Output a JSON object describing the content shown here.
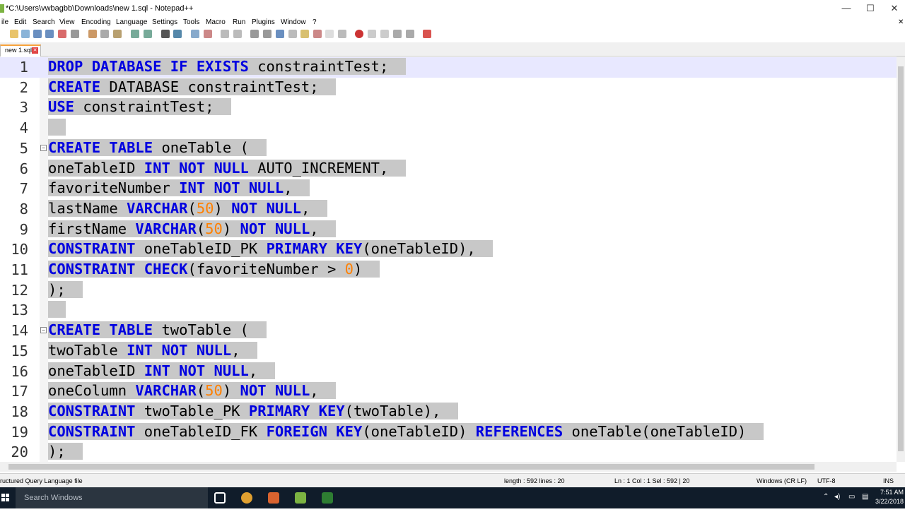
{
  "window": {
    "title": "*C:\\Users\\vwbagbb\\Downloads\\new 1.sql - Notepad++",
    "minimize": "—",
    "maximize": "☐",
    "close": "✕",
    "menu_close": "✕"
  },
  "menu": [
    "ile",
    "Edit",
    "Search",
    "View",
    "Encoding",
    "Language",
    "Settings",
    "Tools",
    "Macro",
    "Run",
    "Plugins",
    "Window",
    "?"
  ],
  "tab": {
    "label": "new 1.sql",
    "close": "✕"
  },
  "lines": [
    {
      "n": "1",
      "tokens": [
        {
          "t": "DROP DATABASE IF EXISTS",
          "k": "kw"
        },
        {
          "t": " constraintTest;",
          "k": ""
        }
      ]
    },
    {
      "n": "2",
      "tokens": [
        {
          "t": "CREATE",
          "k": "kw"
        },
        {
          "t": " DATABASE constraintTest;",
          "k": ""
        }
      ]
    },
    {
      "n": "3",
      "tokens": [
        {
          "t": "USE",
          "k": "kw"
        },
        {
          "t": " constraintTest;",
          "k": ""
        }
      ]
    },
    {
      "n": "4",
      "tokens": []
    },
    {
      "n": "5",
      "fold": true,
      "tokens": [
        {
          "t": "CREATE TABLE",
          "k": "kw"
        },
        {
          "t": " oneTable (",
          "k": ""
        }
      ]
    },
    {
      "n": "6",
      "tokens": [
        {
          "t": "oneTableID ",
          "k": ""
        },
        {
          "t": "INT NOT NULL",
          "k": "kw"
        },
        {
          "t": " AUTO_INCREMENT,",
          "k": ""
        }
      ]
    },
    {
      "n": "7",
      "tokens": [
        {
          "t": "favoriteNumber ",
          "k": ""
        },
        {
          "t": "INT NOT NULL",
          "k": "kw"
        },
        {
          "t": ",",
          "k": ""
        }
      ]
    },
    {
      "n": "8",
      "tokens": [
        {
          "t": "lastName ",
          "k": ""
        },
        {
          "t": "VARCHAR",
          "k": "kw"
        },
        {
          "t": "(",
          "k": ""
        },
        {
          "t": "50",
          "k": "num"
        },
        {
          "t": ") ",
          "k": ""
        },
        {
          "t": "NOT NULL",
          "k": "kw"
        },
        {
          "t": ",",
          "k": ""
        }
      ]
    },
    {
      "n": "9",
      "tokens": [
        {
          "t": "firstName ",
          "k": ""
        },
        {
          "t": "VARCHAR",
          "k": "kw"
        },
        {
          "t": "(",
          "k": ""
        },
        {
          "t": "50",
          "k": "num"
        },
        {
          "t": ") ",
          "k": ""
        },
        {
          "t": "NOT NULL",
          "k": "kw"
        },
        {
          "t": ",",
          "k": ""
        }
      ]
    },
    {
      "n": "10",
      "tokens": [
        {
          "t": "CONSTRAINT",
          "k": "kw"
        },
        {
          "t": " oneTableID_PK ",
          "k": ""
        },
        {
          "t": "PRIMARY KEY",
          "k": "kw"
        },
        {
          "t": "(oneTableID),",
          "k": ""
        }
      ]
    },
    {
      "n": "11",
      "tokens": [
        {
          "t": "CONSTRAINT CHECK",
          "k": "kw"
        },
        {
          "t": "(favoriteNumber > ",
          "k": ""
        },
        {
          "t": "0",
          "k": "num"
        },
        {
          "t": ")",
          "k": ""
        }
      ]
    },
    {
      "n": "12",
      "tokens": [
        {
          "t": ");",
          "k": ""
        }
      ]
    },
    {
      "n": "13",
      "tokens": []
    },
    {
      "n": "14",
      "fold": true,
      "tokens": [
        {
          "t": "CREATE TABLE",
          "k": "kw"
        },
        {
          "t": " twoTable (",
          "k": ""
        }
      ]
    },
    {
      "n": "15",
      "tokens": [
        {
          "t": "twoTable ",
          "k": ""
        },
        {
          "t": "INT NOT NULL",
          "k": "kw"
        },
        {
          "t": ",",
          "k": ""
        }
      ]
    },
    {
      "n": "16",
      "tokens": [
        {
          "t": "oneTableID ",
          "k": ""
        },
        {
          "t": "INT NOT NULL",
          "k": "kw"
        },
        {
          "t": ",",
          "k": ""
        }
      ]
    },
    {
      "n": "17",
      "tokens": [
        {
          "t": "oneColumn ",
          "k": ""
        },
        {
          "t": "VARCHAR",
          "k": "kw"
        },
        {
          "t": "(",
          "k": ""
        },
        {
          "t": "50",
          "k": "num"
        },
        {
          "t": ") ",
          "k": ""
        },
        {
          "t": "NOT NULL",
          "k": "kw"
        },
        {
          "t": ",",
          "k": ""
        }
      ]
    },
    {
      "n": "18",
      "tokens": [
        {
          "t": "CONSTRAINT",
          "k": "kw"
        },
        {
          "t": " twoTable_PK ",
          "k": ""
        },
        {
          "t": "PRIMARY KEY",
          "k": "kw"
        },
        {
          "t": "(twoTable),",
          "k": ""
        }
      ]
    },
    {
      "n": "19",
      "tokens": [
        {
          "t": "CONSTRAINT",
          "k": "kw"
        },
        {
          "t": " oneTableID_FK ",
          "k": ""
        },
        {
          "t": "FOREIGN KEY",
          "k": "kw"
        },
        {
          "t": "(oneTableID) ",
          "k": ""
        },
        {
          "t": "REFERENCES",
          "k": "kw"
        },
        {
          "t": " oneTable(oneTableID)",
          "k": ""
        }
      ]
    },
    {
      "n": "20",
      "tokens": [
        {
          "t": ");",
          "k": ""
        }
      ]
    }
  ],
  "status": {
    "filetype": "ructured Query Language file",
    "length": "length : 592    lines : 20",
    "position": "Ln : 1    Col : 1    Sel : 592 | 20",
    "eol": "Windows (CR LF)",
    "encoding": "UTF-8",
    "mode": "INS"
  },
  "taskbar": {
    "search_placeholder": "Search Windows",
    "time": "7:51 AM",
    "date": "3/22/2018"
  },
  "colors": {
    "keyword": "#0000e0",
    "number": "#ff8000",
    "selection": "#c8c8c8",
    "taskbar": "#101c2a"
  }
}
